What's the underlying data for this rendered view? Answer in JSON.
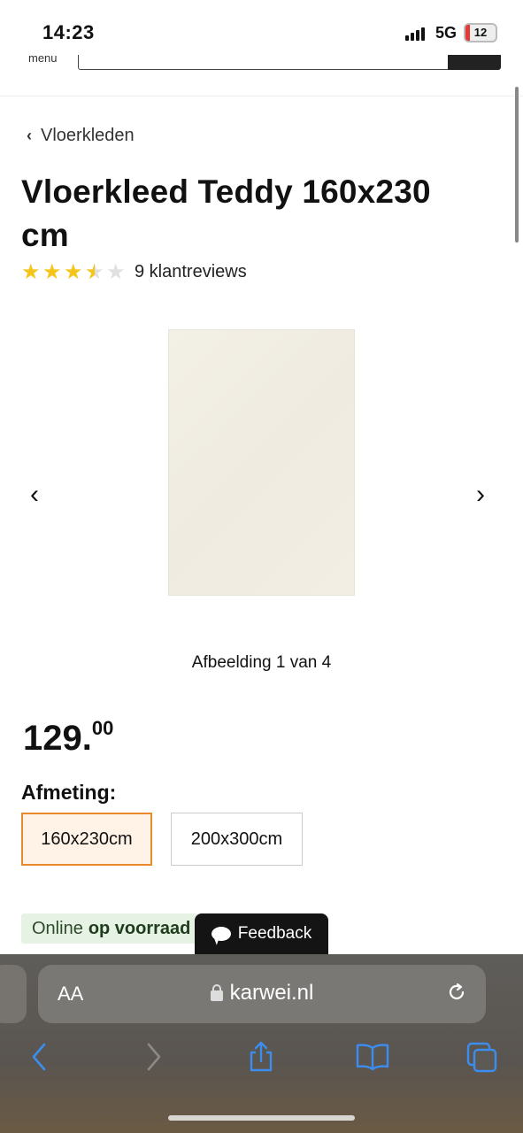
{
  "status_bar": {
    "time": "14:23",
    "network": "5G",
    "battery": "12"
  },
  "header": {
    "menu_label": "menu"
  },
  "breadcrumb": {
    "label": "Vloerkleden"
  },
  "product": {
    "title": "Vloerkleed Teddy 160x230 cm",
    "rating": 3.5,
    "rating_max": 5,
    "reviews_label": "9 klantreviews",
    "image_caption": "Afbeelding 1 van 4",
    "price_main": "129.",
    "price_cents": "00",
    "size_label": "Afmeting:",
    "sizes": [
      {
        "label": "160x230cm",
        "selected": true
      },
      {
        "label": "200x300cm",
        "selected": false
      }
    ],
    "stock_prefix": "Online",
    "stock_status": "op voorraad"
  },
  "feedback": {
    "label": "Feedback"
  },
  "browser": {
    "text_size_label": "AA",
    "url": "karwei.nl"
  },
  "colors": {
    "accent": "#e8892b",
    "star": "#f5c518",
    "stock_bg": "#e6f2e4",
    "ios_blue": "#3b8ef0"
  }
}
